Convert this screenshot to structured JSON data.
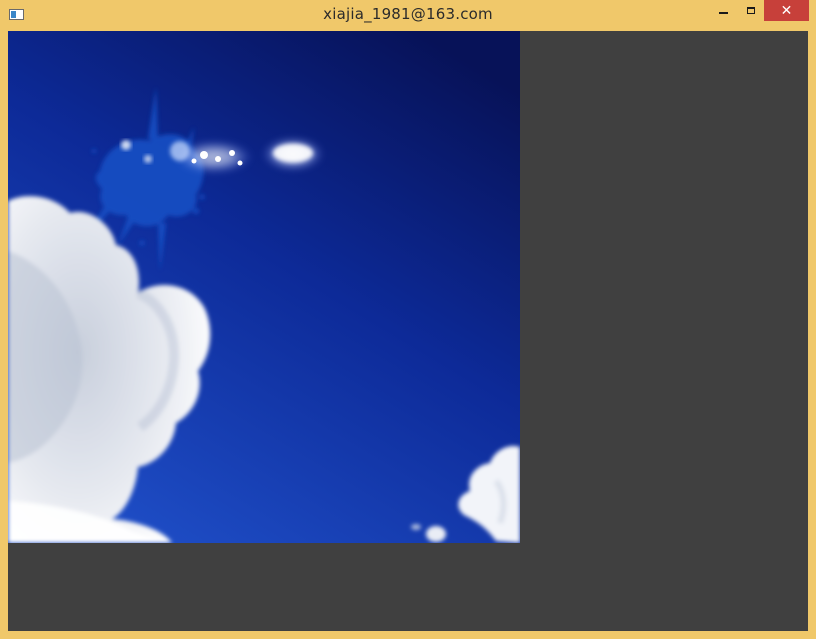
{
  "window": {
    "title": "xiajia_1981@163.com",
    "border_color": "#f0c86a",
    "client_bg": "#404040",
    "close_bg": "#c7403a"
  },
  "controls": {
    "app_icon": "app-window-icon",
    "minimize_icon": "minimize-icon",
    "maximize_icon": "maximize-icon",
    "close_icon": "close-icon",
    "close_glyph": "✕"
  },
  "image": {
    "subject": "blue sky with clouds and ink splash",
    "sky_colors": [
      "#0a1a72",
      "#1236a8",
      "#1e4cc4"
    ]
  }
}
